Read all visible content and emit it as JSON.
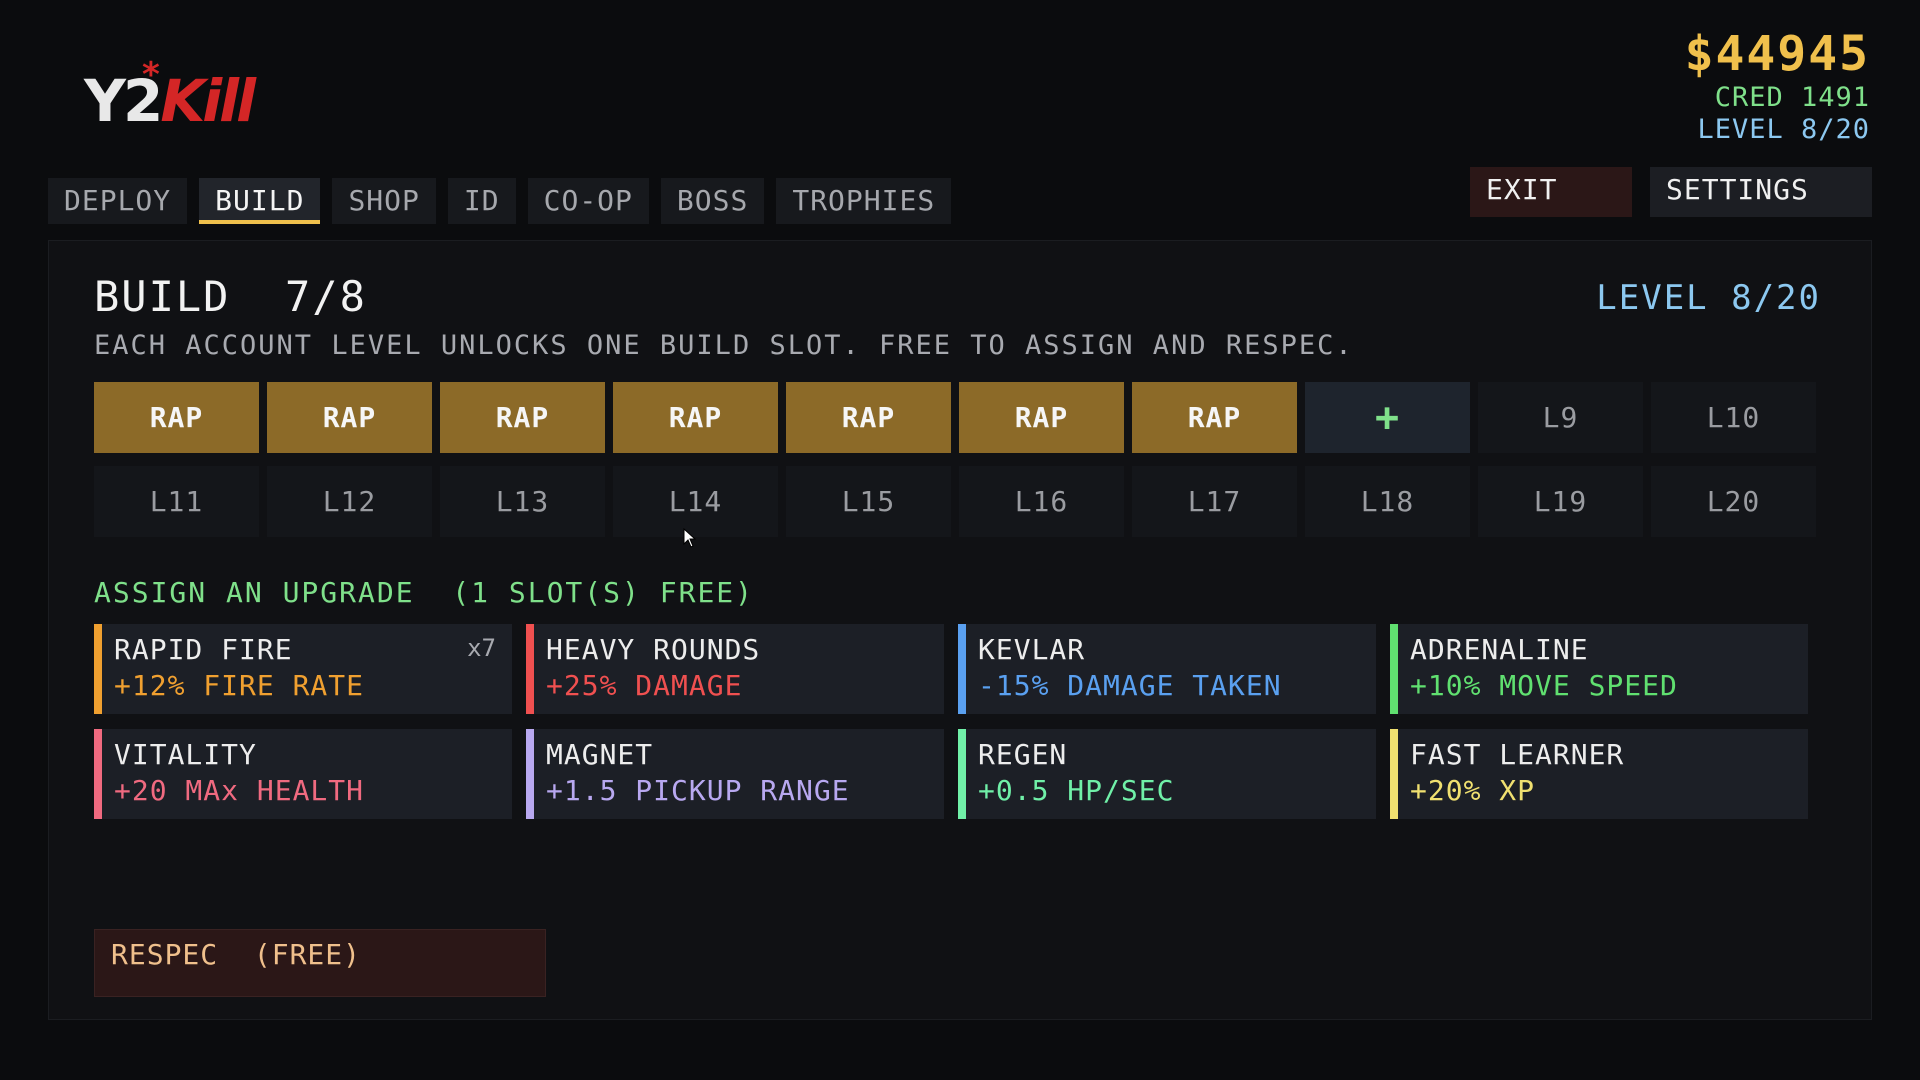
{
  "logo": {
    "text": "Y2Kill"
  },
  "hud": {
    "money": "$44945",
    "cred": "CRED 1491",
    "level": "LEVEL 8/20"
  },
  "tabs": [
    {
      "label": "DEPLOY",
      "active": false
    },
    {
      "label": "BUILD",
      "active": true
    },
    {
      "label": "SHOP",
      "active": false
    },
    {
      "label": "ID",
      "active": false
    },
    {
      "label": "CO-OP",
      "active": false
    },
    {
      "label": "BOSS",
      "active": false
    },
    {
      "label": "TROPHIES",
      "active": false
    }
  ],
  "buttons": {
    "exit": "EXIT",
    "settings": "SETTINGS"
  },
  "build": {
    "title": "BUILD  7/8",
    "level": "LEVEL 8/20",
    "subtitle": "EACH ACCOUNT LEVEL UNLOCKS ONE BUILD SLOT. FREE TO ASSIGN AND RESPEC.",
    "slots": [
      {
        "label": "RAP",
        "state": "filled"
      },
      {
        "label": "RAP",
        "state": "filled"
      },
      {
        "label": "RAP",
        "state": "filled"
      },
      {
        "label": "RAP",
        "state": "filled"
      },
      {
        "label": "RAP",
        "state": "filled"
      },
      {
        "label": "RAP",
        "state": "filled"
      },
      {
        "label": "RAP",
        "state": "filled"
      },
      {
        "label": "+",
        "state": "add"
      },
      {
        "label": "L9",
        "state": "locked"
      },
      {
        "label": "L10",
        "state": "locked"
      },
      {
        "label": "L11",
        "state": "locked"
      },
      {
        "label": "L12",
        "state": "locked"
      },
      {
        "label": "L13",
        "state": "locked"
      },
      {
        "label": "L14",
        "state": "locked"
      },
      {
        "label": "L15",
        "state": "locked"
      },
      {
        "label": "L16",
        "state": "locked"
      },
      {
        "label": "L17",
        "state": "locked"
      },
      {
        "label": "L18",
        "state": "locked"
      },
      {
        "label": "L19",
        "state": "locked"
      },
      {
        "label": "L20",
        "state": "locked"
      }
    ],
    "assign_label": "ASSIGN AN UPGRADE  (1 SLOT(S) FREE)",
    "upgrades": [
      {
        "name": "RAPID FIRE",
        "desc": "+12% FIRE RATE",
        "count": "x7",
        "color": "#f0a030"
      },
      {
        "name": "HEAVY ROUNDS",
        "desc": "+25% DAMAGE",
        "count": "",
        "color": "#f05050"
      },
      {
        "name": "KEVLAR",
        "desc": "-15% DAMAGE TAKEN",
        "count": "",
        "color": "#5aa0f0"
      },
      {
        "name": "ADRENALINE",
        "desc": "+10% MOVE SPEED",
        "count": "",
        "color": "#60e070"
      },
      {
        "name": "VITALITY",
        "desc": "+20 MAx HEALTH",
        "count": "",
        "color": "#f06a80"
      },
      {
        "name": "MAGNET",
        "desc": "+1.5 PICKUP RANGE",
        "count": "",
        "color": "#b8a8f0"
      },
      {
        "name": "REGEN",
        "desc": "+0.5 HP/SEC",
        "count": "",
        "color": "#70f0a8"
      },
      {
        "name": "FAST LEARNER",
        "desc": "+20% XP",
        "count": "",
        "color": "#f0e070"
      }
    ],
    "respec": "RESPEC  (FREE)"
  },
  "colors": {
    "accent": "#f0c04c",
    "green": "#7fe08a",
    "blue": "#8cc8f0",
    "slot_filled": "#8c6a28"
  }
}
